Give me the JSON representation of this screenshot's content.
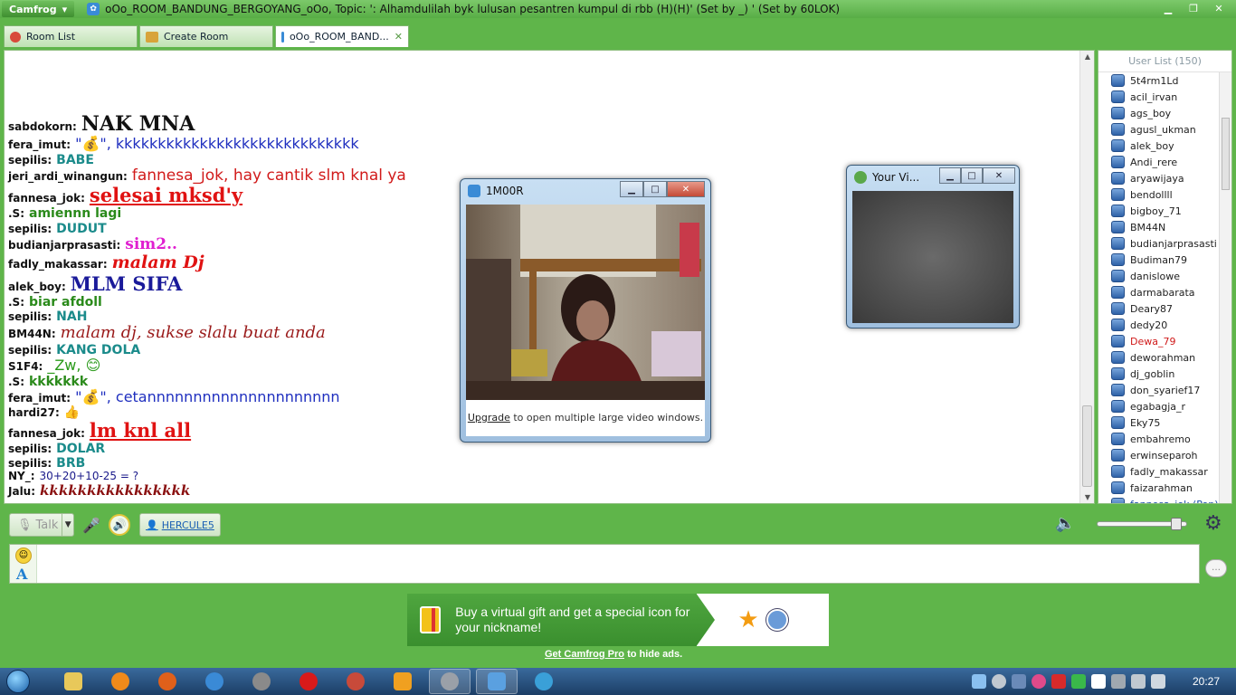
{
  "window": {
    "app_menu": "Camfrog",
    "title": "oOo_ROOM_BANDUNG_BERGOYANG_oOo, Topic: ': Alhamdulilah byk lulusan pesantren kumpul di rbb (H)(H)' (Set by _)      ' (Set by 60LOK)"
  },
  "tabs": [
    {
      "label": "Room List"
    },
    {
      "label": "Create Room"
    },
    {
      "label": "oOo_ROOM_BAND...",
      "close": "✕"
    }
  ],
  "messages": [
    {
      "nick": "sabdokorn:",
      "text": "NAK MNA",
      "color": "#111111",
      "size": 22,
      "style": "bold",
      "font": "\"DejaVu Serif\", serif"
    },
    {
      "nick": "fera_imut:",
      "text": "\"💰\", kkkkkkkkkkkkkkkkkkkkkkkkkkkkk",
      "color": "#1f2fbf",
      "size": 16,
      "style": "normal",
      "font": "\"DejaVu Sans\", sans-serif"
    },
    {
      "nick": "sepilis:",
      "text": "BABE",
      "color": "#1b8b8b",
      "size": 14,
      "style": "bold",
      "font": "\"DejaVu Sans\", sans-serif"
    },
    {
      "nick": "jeri_ardi_winangun:",
      "text": "fannesa_jok, hay cantik slm knal ya",
      "color": "#d11a1a",
      "size": 17,
      "style": "normal",
      "font": "\"DejaVu Sans\", sans-serif"
    },
    {
      "nick": "fannesa_jok:",
      "text": "selesai mksd'y",
      "color": "#e01212",
      "size": 21,
      "style": "bold-underline",
      "font": "\"DejaVu Serif\", serif"
    },
    {
      "nick": ".S:",
      "text": "amiennn lagi",
      "color": "#2a8a1a",
      "size": 14,
      "style": "bold",
      "font": "\"DejaVu Sans\", sans-serif"
    },
    {
      "nick": "sepilis:",
      "text": "DUDUT",
      "color": "#1b8b8b",
      "size": 14,
      "style": "bold",
      "font": "\"DejaVu Sans\", sans-serif"
    },
    {
      "nick": "budianjarprasasti:",
      "text": "sim2..",
      "color": "#e020d0",
      "size": 17,
      "style": "bold",
      "font": "\"DejaVu Serif\", serif"
    },
    {
      "nick": "fadly_makassar:",
      "text": "malam Dj",
      "color": "#e01212",
      "size": 19,
      "style": "bold-italic",
      "font": "\"DejaVu Serif\", serif"
    },
    {
      "nick": "alek_boy:",
      "text": "MLM SIFA",
      "color": "#1a1a9a",
      "size": 21,
      "style": "bold",
      "font": "\"DejaVu Serif\", serif"
    },
    {
      "nick": ".S:",
      "text": "biar afdoll",
      "color": "#2a8a1a",
      "size": 14,
      "style": "bold",
      "font": "\"DejaVu Sans\", sans-serif"
    },
    {
      "nick": "sepilis:",
      "text": "NAH",
      "color": "#1b8b8b",
      "size": 14,
      "style": "bold",
      "font": "\"DejaVu Sans\", sans-serif"
    },
    {
      "nick": "BM44N:",
      "text": "malam dj, sukse slalu buat anda",
      "color": "#9a1a1a",
      "size": 18,
      "style": "italic",
      "font": "\"DejaVu Serif\", serif"
    },
    {
      "nick": "sepilis:",
      "text": "KANG DOLA",
      "color": "#1b8b8b",
      "size": 14,
      "style": "bold",
      "font": "\"DejaVu Sans\", sans-serif"
    },
    {
      "nick": "S1F4:",
      "text": "_Zw, 😊",
      "color": "#2a9a1a",
      "size": 16,
      "style": "normal",
      "font": "\"DejaVu Sans\", sans-serif"
    },
    {
      "nick": ".S:",
      "text": "kkkkkkk",
      "color": "#2a8a1a",
      "size": 14,
      "style": "bold",
      "font": "\"DejaVu Sans\", sans-serif"
    },
    {
      "nick": "fera_imut:",
      "text": "\"💰\", cetannnnnnnnnnnnnnnnnnnnn",
      "color": "#1f2fbf",
      "size": 16,
      "style": "normal",
      "font": "\"DejaVu Sans\", sans-serif"
    },
    {
      "nick": "hardi27:",
      "text": "👍",
      "color": "#222222",
      "size": 14,
      "style": "normal",
      "font": "\"DejaVu Sans\", sans-serif"
    },
    {
      "nick": "fannesa_jok:",
      "text": "lm knl all",
      "color": "#e01212",
      "size": 21,
      "style": "bold-underline",
      "font": "\"DejaVu Serif\", serif"
    },
    {
      "nick": "sepilis:",
      "text": "DOLAR",
      "color": "#1b8b8b",
      "size": 14,
      "style": "bold",
      "font": "\"DejaVu Sans\", sans-serif"
    },
    {
      "nick": "sepilis:",
      "text": "BRB",
      "color": "#1b8b8b",
      "size": 14,
      "style": "bold",
      "font": "\"DejaVu Sans\", sans-serif"
    },
    {
      "nick": "NY_:",
      "text": "30+20+10-25 = ?",
      "color": "#1a1a8a",
      "size": 12,
      "style": "normal",
      "font": "\"DejaVu Sans\", sans-serif"
    },
    {
      "nick": "Jalu:",
      "text": "kkkkkkkkkkkkkkkk",
      "color": "#8a1010",
      "size": 15,
      "style": "bold-italic",
      "font": "\"DejaVu Serif\", serif"
    }
  ],
  "userlist": {
    "header": "User List (150)",
    "users": [
      {
        "name": "5t4rm1Ld",
        "color": "#222222"
      },
      {
        "name": "acil_irvan",
        "color": "#222222"
      },
      {
        "name": "ags_boy",
        "color": "#222222"
      },
      {
        "name": "agusl_ukman",
        "color": "#222222"
      },
      {
        "name": "alek_boy",
        "color": "#222222"
      },
      {
        "name": "Andi_rere",
        "color": "#222222"
      },
      {
        "name": "aryawijaya",
        "color": "#222222"
      },
      {
        "name": "bendollll",
        "color": "#222222"
      },
      {
        "name": "bigboy_71",
        "color": "#222222"
      },
      {
        "name": "BM44N",
        "color": "#222222"
      },
      {
        "name": "budianjarprasasti",
        "color": "#222222"
      },
      {
        "name": "Budiman79",
        "color": "#222222"
      },
      {
        "name": "danislowe",
        "color": "#222222"
      },
      {
        "name": "darmabarata",
        "color": "#222222"
      },
      {
        "name": "Deary87",
        "color": "#222222"
      },
      {
        "name": "dedy20",
        "color": "#222222"
      },
      {
        "name": "Dewa_79",
        "color": "#d01a1a"
      },
      {
        "name": "deworahman",
        "color": "#222222"
      },
      {
        "name": "dj_goblin",
        "color": "#222222"
      },
      {
        "name": "don_syarief17",
        "color": "#222222"
      },
      {
        "name": "egabagja_r",
        "color": "#222222"
      },
      {
        "name": "Eky75",
        "color": "#222222"
      },
      {
        "name": "embahremo",
        "color": "#222222"
      },
      {
        "name": "erwinseparoh",
        "color": "#222222"
      },
      {
        "name": "fadly_makassar",
        "color": "#222222"
      },
      {
        "name": "faizarahman",
        "color": "#222222"
      },
      {
        "name": "fannesa_jok (Pop)",
        "color": "#1a4fa8"
      }
    ]
  },
  "toolbar": {
    "talk_label": "Talk",
    "speaker_label": "HERCULE5",
    "volume_level": 0.92
  },
  "input": {
    "smiley": "☺",
    "font_button": "A",
    "value": ""
  },
  "ad": {
    "text": "Buy a virtual gift and get a special icon for your nickname!",
    "pro_link": "Get Camfrog Pro",
    "pro_suffix": " to hide ads."
  },
  "video_main": {
    "title": "1M00R",
    "upgrade_link": "Upgrade",
    "upgrade_suffix": " to open multiple large video windows."
  },
  "video_self": {
    "title": "Your Vi..."
  },
  "taskbar": {
    "clock": "20:27"
  },
  "colors": {
    "window_green": "#5fb54a",
    "accent_blue": "#1a5fb4"
  }
}
